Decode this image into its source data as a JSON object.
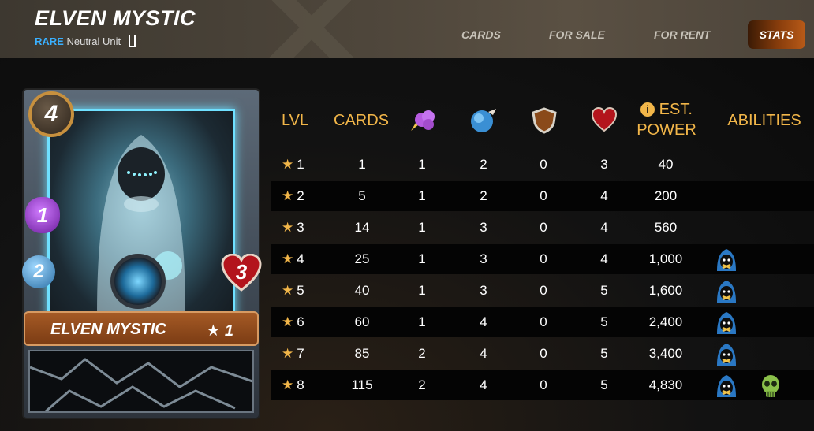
{
  "header": {
    "title": "ELVEN MYSTIC",
    "rarity": "RARE",
    "unit_type": "Neutral Unit",
    "tabs": [
      "CARDS",
      "FOR SALE",
      "FOR RENT"
    ],
    "active_tab": "STATS"
  },
  "card": {
    "mana": "4",
    "magic": "1",
    "speed": "2",
    "health": "3",
    "name": "ELVEN MYSTIC",
    "level": "★ 1"
  },
  "table": {
    "headers": {
      "lvl": "LVL",
      "cards": "CARDS",
      "magic_icon": "magic-attack-icon",
      "speed_icon": "speed-icon",
      "armor_icon": "armor-shield-icon",
      "health_icon": "health-heart-icon",
      "power_info_icon": "info-icon",
      "power_line1": "EST.",
      "power_line2": "POWER",
      "abilities": "ABILITIES"
    },
    "rows": [
      {
        "lvl": "1",
        "cards": "1",
        "magic": "1",
        "speed": "2",
        "armor": "0",
        "health": "3",
        "power": "40",
        "abilities": []
      },
      {
        "lvl": "2",
        "cards": "5",
        "magic": "1",
        "speed": "2",
        "armor": "0",
        "health": "4",
        "power": "200",
        "abilities": []
      },
      {
        "lvl": "3",
        "cards": "14",
        "magic": "1",
        "speed": "3",
        "armor": "0",
        "health": "4",
        "power": "560",
        "abilities": []
      },
      {
        "lvl": "4",
        "cards": "25",
        "magic": "1",
        "speed": "3",
        "armor": "0",
        "health": "4",
        "power": "1,000",
        "abilities": [
          "silence-icon"
        ]
      },
      {
        "lvl": "5",
        "cards": "40",
        "magic": "1",
        "speed": "3",
        "armor": "0",
        "health": "5",
        "power": "1,600",
        "abilities": [
          "silence-icon"
        ]
      },
      {
        "lvl": "6",
        "cards": "60",
        "magic": "1",
        "speed": "4",
        "armor": "0",
        "health": "5",
        "power": "2,400",
        "abilities": [
          "silence-icon"
        ]
      },
      {
        "lvl": "7",
        "cards": "85",
        "magic": "2",
        "speed": "4",
        "armor": "0",
        "health": "5",
        "power": "3,400",
        "abilities": [
          "silence-icon"
        ]
      },
      {
        "lvl": "8",
        "cards": "115",
        "magic": "2",
        "speed": "4",
        "armor": "0",
        "health": "5",
        "power": "4,830",
        "abilities": [
          "silence-icon",
          "affliction-skull-icon"
        ]
      }
    ]
  },
  "colors": {
    "accent_gold": "#f2b649",
    "rarity_blue": "#3ab0ff",
    "stats_tab": "#8a3e0c"
  }
}
